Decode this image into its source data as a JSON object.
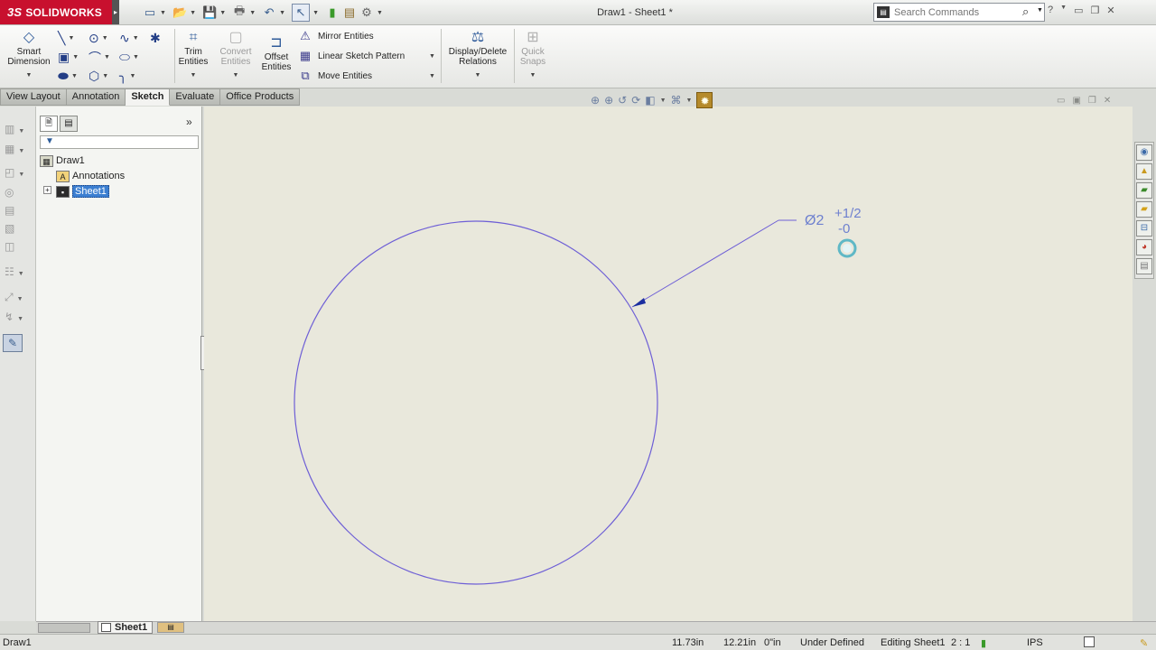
{
  "app": {
    "logo_text": "SOLIDWORKS",
    "logo_prefix": "3S",
    "window_title": "Draw1 - Sheet1 *"
  },
  "search": {
    "placeholder": "Search Commands"
  },
  "commands": {
    "smart_dimension": "Smart Dimension",
    "trim_entities": "Trim Entities",
    "convert_entities": "Convert Entities",
    "offset_entities": "Offset Entities",
    "mirror_entities": "Mirror Entities",
    "linear_sketch_pattern": "Linear Sketch Pattern",
    "move_entities": "Move Entities",
    "display_delete_relations": "Display/Delete Relations",
    "quick_snaps": "Quick Snaps"
  },
  "tabs": [
    "View Layout",
    "Annotation",
    "Sketch",
    "Evaluate",
    "Office Products"
  ],
  "active_tab": "Sketch",
  "tree": {
    "root": "Draw1",
    "annotations": "Annotations",
    "sheet": "Sheet1"
  },
  "sheet_tab": "Sheet1",
  "drawing": {
    "diameter_symbol": "Ø2",
    "upper_tolerance": "+1/2",
    "lower_tolerance": "-0",
    "line_color": "#6e5fd6"
  },
  "status": {
    "document": "Draw1",
    "x_coord": "11.73in",
    "y_coord": "12.21in",
    "z_coord": "0\"in",
    "sketch_state": "Under Defined",
    "editing": "Editing Sheet1",
    "scale": "2 : 1",
    "units": "IPS"
  },
  "colors": {
    "brand": "#c8102e",
    "canvas": "#e9e8dc",
    "selection": "#3c7fd1"
  }
}
